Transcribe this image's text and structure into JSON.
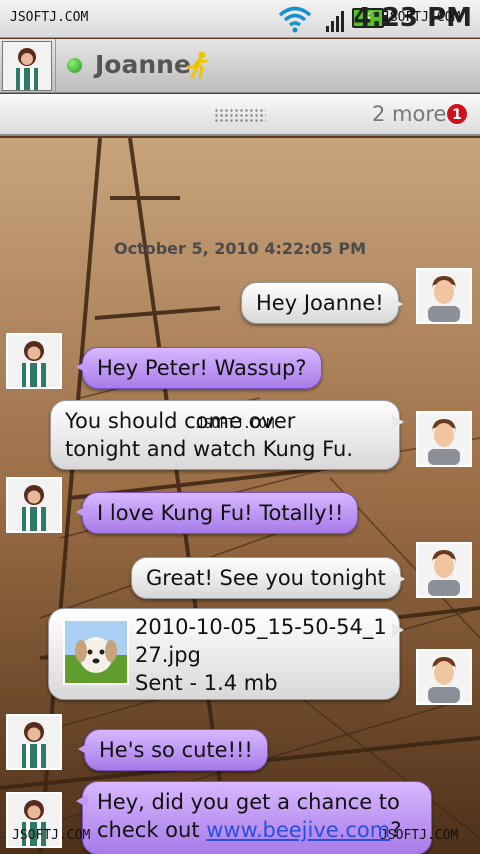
{
  "status_bar": {
    "watermark": "JSOFTJ.COM",
    "time": "4:23 PM",
    "watermark_right": "JSOFTJ.COM",
    "battery_color": "#58c02a"
  },
  "header": {
    "contact_name": "Joanne",
    "presence": "online",
    "presence_color": "#1f9a12",
    "service_icon": "aim-running-man-icon"
  },
  "tabs": {
    "more_label": "2 more",
    "more_count": "1"
  },
  "conversation": {
    "timestamp": "October 5, 2010 4:22:05 PM",
    "watermark_mid": "JSOFTJ.COM",
    "messages": [
      {
        "sender": "me",
        "text": "Hey Joanne!"
      },
      {
        "sender": "joanne",
        "text": "Hey Peter! Wassup?"
      },
      {
        "sender": "me",
        "text_line1": "You should come over",
        "text_line2": "tonight and watch Kung Fu."
      },
      {
        "sender": "joanne",
        "text": "I love Kung Fu! Totally!!"
      },
      {
        "sender": "me",
        "text": "Great! See you tonight"
      },
      {
        "sender": "me",
        "file_name_line1": "2010-10-05_15-50-54_1",
        "file_name_line2": "27.jpg",
        "file_status": "Sent - 1.4 mb"
      },
      {
        "sender": "joanne",
        "text": "He's so cute!!!"
      },
      {
        "sender": "joanne",
        "text_line1": "Hey, did you get a chance to",
        "text_line2_prefix": "check out ",
        "link": "www.beejive.com",
        "text_line2_suffix": "?"
      }
    ],
    "watermark_bottom_left": "JSOFTJ.COM",
    "watermark_bottom_right": "JSOFTJ.COM"
  }
}
